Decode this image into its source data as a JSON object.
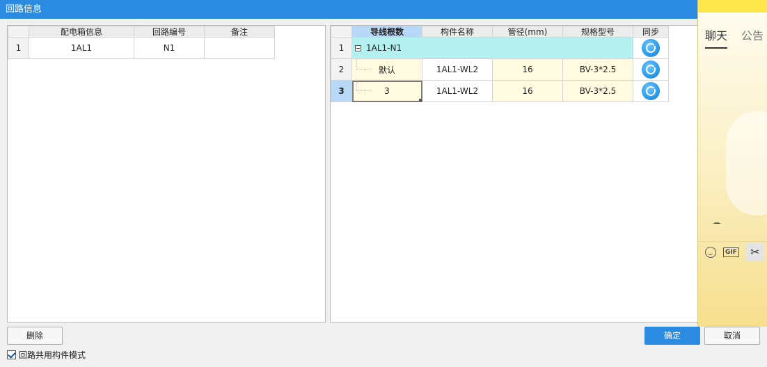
{
  "window": {
    "title": "回路信息"
  },
  "left_table": {
    "columns": [
      "配电箱信息",
      "回路编号",
      "备注"
    ],
    "rows": [
      {
        "num": "1",
        "box": "1AL1",
        "circuit": "N1",
        "note": ""
      }
    ]
  },
  "right_table": {
    "columns": [
      "导线根数",
      "构件名称",
      "管径(mm)",
      "规格型号",
      "同步"
    ],
    "rows": [
      {
        "num": "1",
        "group_label": "1AL1-N1"
      },
      {
        "num": "2",
        "wire_count": "默认",
        "component": "1AL1-WL2",
        "diameter": "16",
        "spec": "BV-3*2.5"
      },
      {
        "num": "3",
        "wire_count": "3",
        "component": "1AL1-WL2",
        "diameter": "16",
        "spec": "BV-3*2.5"
      }
    ]
  },
  "buttons": {
    "delete": "删除",
    "ok": "确定",
    "cancel": "取消"
  },
  "checkbox": {
    "label": "回路共用构件模式",
    "checked": true
  },
  "chat_overlay": {
    "tab_chat": "聊天",
    "tab_notice": "公告",
    "gif_label": "GIF"
  },
  "colors": {
    "titlebar": "#2b8be0",
    "group_row": "#b3f0ef",
    "editable_cell": "#fffbe0",
    "selected_header": "#b8d8f8",
    "ok_button": "#2b8be0"
  }
}
